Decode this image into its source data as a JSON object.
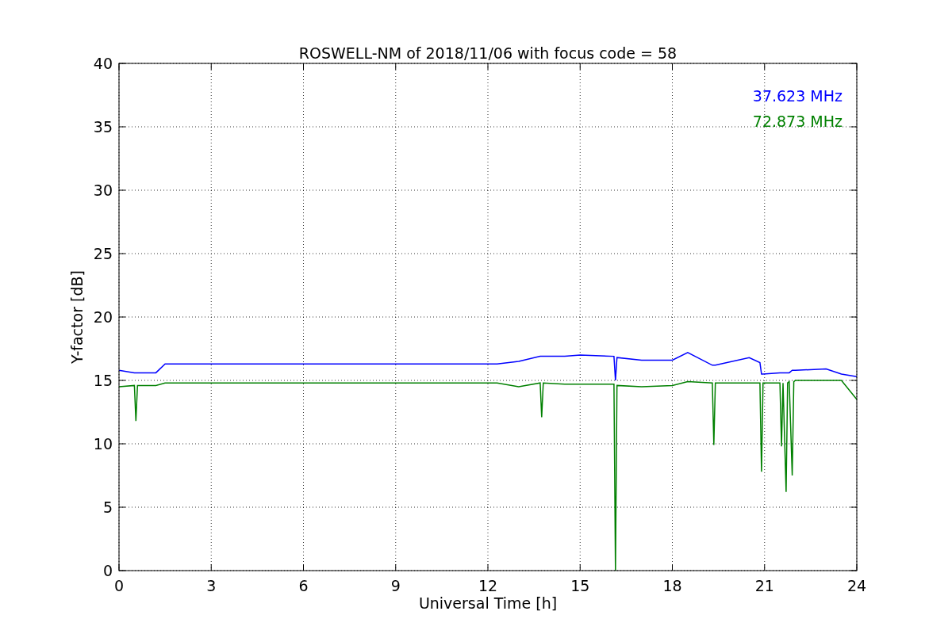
{
  "chart_data": {
    "type": "line",
    "title": "ROSWELL-NM of 2018/11/06 with focus code = 58",
    "xlabel": "Universal Time [h]",
    "ylabel": "Y-factor [dB]",
    "x": [
      0,
      0.5,
      0.55,
      0.6,
      1.2,
      1.5,
      12.3,
      13,
      13.7,
      13.75,
      13.8,
      14.5,
      15,
      16.1,
      16.15,
      16.2,
      17,
      18,
      18.5,
      19.3,
      19.35,
      19.4,
      20.5,
      20.85,
      20.9,
      20.95,
      21.5,
      21.55,
      21.6,
      21.7,
      21.75,
      21.8,
      21.9,
      21.95,
      22,
      23,
      23.5,
      24
    ],
    "series": [
      {
        "name": "37.623 MHz",
        "color": "#0000ff",
        "values": [
          15.8,
          15.6,
          15.6,
          15.6,
          15.6,
          16.3,
          16.3,
          16.5,
          16.9,
          16.9,
          16.9,
          16.9,
          17,
          16.9,
          15,
          16.8,
          16.6,
          16.6,
          17.2,
          16.2,
          16.2,
          16.2,
          16.8,
          16.4,
          15.5,
          15.5,
          15.6,
          15.6,
          15.6,
          15.6,
          15.6,
          15.6,
          15.8,
          15.8,
          15.8,
          15.9,
          15.5,
          15.3
        ]
      },
      {
        "name": "72.873 MHz",
        "color": "#008000",
        "values": [
          14.5,
          14.6,
          11.8,
          14.6,
          14.6,
          14.8,
          14.8,
          14.5,
          14.8,
          12.1,
          14.8,
          14.7,
          14.7,
          14.7,
          0,
          14.6,
          14.5,
          14.6,
          14.9,
          14.8,
          9.9,
          14.8,
          14.8,
          14.8,
          7.8,
          14.8,
          14.8,
          9.8,
          14.8,
          6.2,
          14.8,
          14.9,
          7.5,
          14.9,
          15,
          15,
          15,
          13.5
        ]
      }
    ],
    "grid": true,
    "xlim": [
      0,
      24
    ],
    "ylim": [
      0,
      40
    ],
    "xticks": [
      0,
      3,
      6,
      9,
      12,
      15,
      18,
      21,
      24
    ],
    "yticks": [
      0,
      5,
      10,
      15,
      20,
      25,
      30,
      35,
      40
    ]
  }
}
